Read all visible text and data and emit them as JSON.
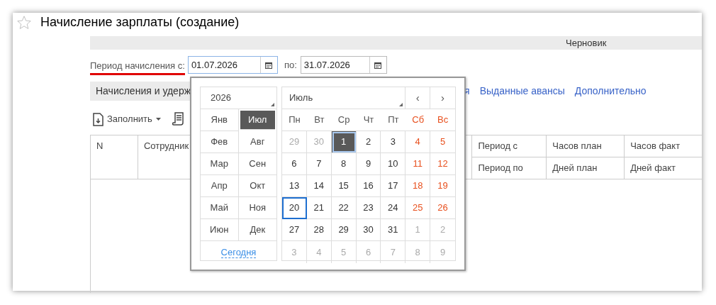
{
  "window": {
    "title": "Начисление зарплаты (создание)",
    "favorite": false
  },
  "status": "Черновик",
  "period": {
    "label": "Период начисления с:",
    "underlined": true,
    "from": {
      "value": "01.07.2026",
      "focused": true
    },
    "to_label": "по:",
    "to": {
      "value": "31.07.2026",
      "focused": false
    }
  },
  "tabs": [
    {
      "label": "Начисления и удерж",
      "selected": true
    },
    {
      "label": "я",
      "selected": false
    },
    {
      "label": "Выданные авансы",
      "selected": false
    },
    {
      "label": "Дополнительно",
      "selected": false
    }
  ],
  "toolbar": {
    "fill_button": "Заполнить"
  },
  "table": {
    "columns": [
      {
        "top": "N"
      },
      {
        "top": "Сотрудник"
      },
      {
        "top": "Период с",
        "bottom": "Период по"
      },
      {
        "top": "Часов план",
        "bottom": "Дней план"
      },
      {
        "top": "Часов факт",
        "bottom": "Дней факт"
      }
    ]
  },
  "calendar": {
    "year": "2026",
    "month": "Июль",
    "prev": "‹",
    "next": "›",
    "today_link": "Сегодня",
    "months": [
      {
        "label": "Янв",
        "selected": false
      },
      {
        "label": "Июл",
        "selected": true
      },
      {
        "label": "Фев",
        "selected": false
      },
      {
        "label": "Авг",
        "selected": false
      },
      {
        "label": "Мар",
        "selected": false
      },
      {
        "label": "Сен",
        "selected": false
      },
      {
        "label": "Апр",
        "selected": false
      },
      {
        "label": "Окт",
        "selected": false
      },
      {
        "label": "Май",
        "selected": false
      },
      {
        "label": "Ноя",
        "selected": false
      },
      {
        "label": "Июн",
        "selected": false
      },
      {
        "label": "Дек",
        "selected": false
      }
    ],
    "weekdays": [
      {
        "label": "Пн",
        "kind": "work"
      },
      {
        "label": "Вт",
        "kind": "work"
      },
      {
        "label": "Ср",
        "kind": "work"
      },
      {
        "label": "Чт",
        "kind": "work"
      },
      {
        "label": "Пт",
        "kind": "work"
      },
      {
        "label": "Сб",
        "kind": "weekend"
      },
      {
        "label": "Вс",
        "kind": "weekend"
      }
    ],
    "days": [
      {
        "label": "29",
        "kind": "other",
        "selected": false,
        "today": false
      },
      {
        "label": "30",
        "kind": "other",
        "selected": false,
        "today": false
      },
      {
        "label": "1",
        "kind": "work",
        "selected": true,
        "today": false
      },
      {
        "label": "2",
        "kind": "work",
        "selected": false,
        "today": false
      },
      {
        "label": "3",
        "kind": "work",
        "selected": false,
        "today": false
      },
      {
        "label": "4",
        "kind": "weekend",
        "selected": false,
        "today": false
      },
      {
        "label": "5",
        "kind": "weekend",
        "selected": false,
        "today": false
      },
      {
        "label": "6",
        "kind": "work",
        "selected": false,
        "today": false
      },
      {
        "label": "7",
        "kind": "work",
        "selected": false,
        "today": false
      },
      {
        "label": "8",
        "kind": "work",
        "selected": false,
        "today": false
      },
      {
        "label": "9",
        "kind": "work",
        "selected": false,
        "today": false
      },
      {
        "label": "10",
        "kind": "work",
        "selected": false,
        "today": false
      },
      {
        "label": "11",
        "kind": "weekend",
        "selected": false,
        "today": false
      },
      {
        "label": "12",
        "kind": "weekend",
        "selected": false,
        "today": false
      },
      {
        "label": "13",
        "kind": "work",
        "selected": false,
        "today": false
      },
      {
        "label": "14",
        "kind": "work",
        "selected": false,
        "today": false
      },
      {
        "label": "15",
        "kind": "work",
        "selected": false,
        "today": false
      },
      {
        "label": "16",
        "kind": "work",
        "selected": false,
        "today": false
      },
      {
        "label": "17",
        "kind": "work",
        "selected": false,
        "today": false
      },
      {
        "label": "18",
        "kind": "weekend",
        "selected": false,
        "today": false
      },
      {
        "label": "19",
        "kind": "weekend",
        "selected": false,
        "today": false
      },
      {
        "label": "20",
        "kind": "work",
        "selected": false,
        "today": true
      },
      {
        "label": "21",
        "kind": "work",
        "selected": false,
        "today": false
      },
      {
        "label": "22",
        "kind": "work",
        "selected": false,
        "today": false
      },
      {
        "label": "23",
        "kind": "work",
        "selected": false,
        "today": false
      },
      {
        "label": "24",
        "kind": "work",
        "selected": false,
        "today": false
      },
      {
        "label": "25",
        "kind": "weekend",
        "selected": false,
        "today": false
      },
      {
        "label": "26",
        "kind": "weekend",
        "selected": false,
        "today": false
      },
      {
        "label": "27",
        "kind": "work",
        "selected": false,
        "today": false
      },
      {
        "label": "28",
        "kind": "work",
        "selected": false,
        "today": false
      },
      {
        "label": "29",
        "kind": "work",
        "selected": false,
        "today": false
      },
      {
        "label": "30",
        "kind": "work",
        "selected": false,
        "today": false
      },
      {
        "label": "31",
        "kind": "work",
        "selected": false,
        "today": false
      },
      {
        "label": "1",
        "kind": "other",
        "selected": false,
        "today": false
      },
      {
        "label": "2",
        "kind": "other",
        "selected": false,
        "today": false
      },
      {
        "label": "3",
        "kind": "other",
        "selected": false,
        "today": false
      },
      {
        "label": "4",
        "kind": "other",
        "selected": false,
        "today": false
      },
      {
        "label": "5",
        "kind": "other",
        "selected": false,
        "today": false
      },
      {
        "label": "6",
        "kind": "other",
        "selected": false,
        "today": false
      },
      {
        "label": "7",
        "kind": "other",
        "selected": false,
        "today": false
      },
      {
        "label": "8",
        "kind": "other",
        "selected": false,
        "today": false
      },
      {
        "label": "9",
        "kind": "other",
        "selected": false,
        "today": false
      }
    ]
  }
}
